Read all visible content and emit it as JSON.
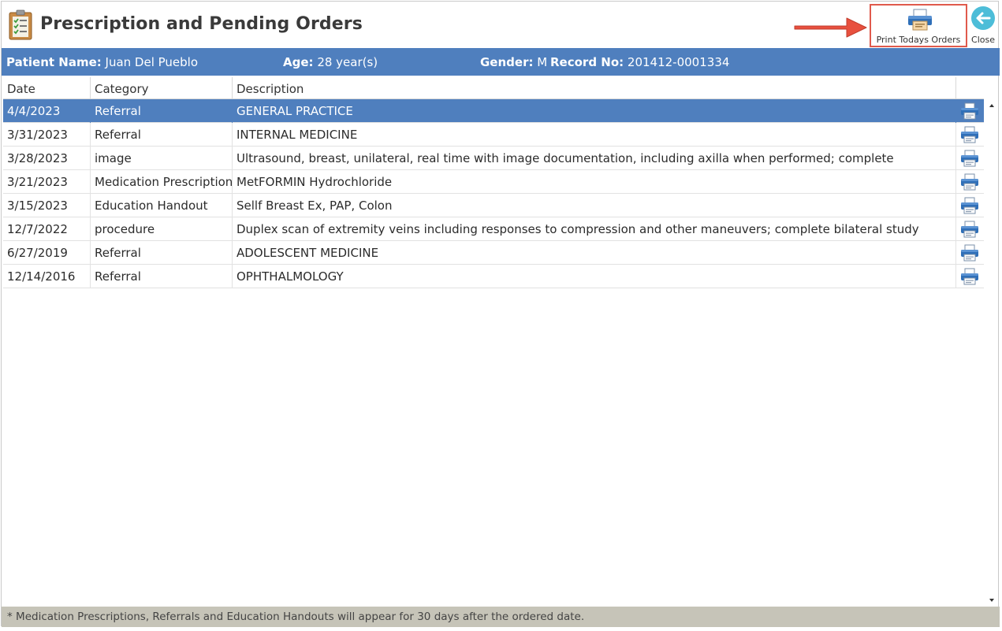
{
  "window": {
    "title": "Prescription and Pending Orders"
  },
  "toolbar": {
    "print_todays_orders_label": "Print Todays Orders",
    "close_label": "Close"
  },
  "patient": {
    "name_label": "Patient Name:",
    "name": "Juan Del Pueblo",
    "age_label": "Age:",
    "age": "28 year(s)",
    "gender_label": "Gender:",
    "gender": "M",
    "record_label": "Record No:",
    "record": "201412-0001334"
  },
  "grid": {
    "columns": [
      "Date",
      "Category",
      "Description"
    ],
    "rows": [
      {
        "date": "4/4/2023",
        "category": "Referral",
        "description": "GENERAL PRACTICE",
        "selected": true
      },
      {
        "date": "3/31/2023",
        "category": "Referral",
        "description": "INTERNAL MEDICINE"
      },
      {
        "date": "3/28/2023",
        "category": "image",
        "description": "Ultrasound, breast, unilateral, real time with image documentation, including axilla when performed; complete"
      },
      {
        "date": "3/21/2023",
        "category": "Medication Prescription",
        "description": "MetFORMIN Hydrochloride"
      },
      {
        "date": "3/15/2023",
        "category": "Education Handout",
        "description": "Sellf Breast Ex, PAP, Colon"
      },
      {
        "date": "12/7/2022",
        "category": "procedure",
        "description": "Duplex scan of extremity veins including responses to compression and other maneuvers; complete bilateral study"
      },
      {
        "date": "6/27/2019",
        "category": "Referral",
        "description": "ADOLESCENT MEDICINE"
      },
      {
        "date": "12/14/2016",
        "category": "Referral",
        "description": "OPHTHALMOLOGY"
      }
    ]
  },
  "footer": {
    "note": "* Medication Prescriptions, Referrals and Education Handouts will appear for 30 days after the ordered date."
  },
  "icons": {
    "title": "clipboard-checklist-icon",
    "print_todays": "printer-icon",
    "close": "back-arrow-icon",
    "row_print": "printer-icon",
    "annotation": "red-arrow-icon"
  },
  "colors": {
    "accent": "#4f7fbe",
    "highlight_box": "#e05a4c",
    "annotation_arrow": "#e8503e",
    "close_button": "#4dbdd8",
    "footer_bg": "#c6c4b8"
  }
}
